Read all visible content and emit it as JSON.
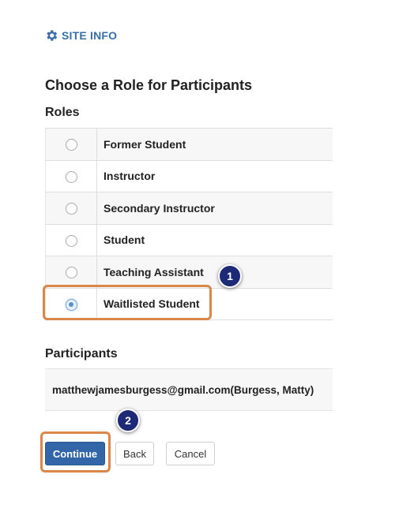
{
  "header": {
    "site_info_label": "SITE INFO",
    "icon": "gear-icon"
  },
  "page": {
    "title": "Choose a Role for Participants",
    "roles_heading": "Roles",
    "participants_heading": "Participants"
  },
  "roles": [
    {
      "label": "Former Student",
      "selected": false
    },
    {
      "label": "Instructor",
      "selected": false
    },
    {
      "label": "Secondary Instructor",
      "selected": false
    },
    {
      "label": "Student",
      "selected": false
    },
    {
      "label": "Teaching Assistant",
      "selected": false
    },
    {
      "label": "Waitlisted Student",
      "selected": true
    }
  ],
  "participants": [
    "matthewjamesburgess@gmail.com(Burgess, Matty)"
  ],
  "annotations": {
    "step1": "1",
    "step2": "2",
    "highlight_color": "#d9884a",
    "badge_color": "#1c2a78"
  },
  "buttons": {
    "continue_label": "Continue",
    "back_label": "Back",
    "cancel_label": "Cancel"
  },
  "colors": {
    "link_blue": "#3a6fa8",
    "primary_button": "#3266a8"
  }
}
